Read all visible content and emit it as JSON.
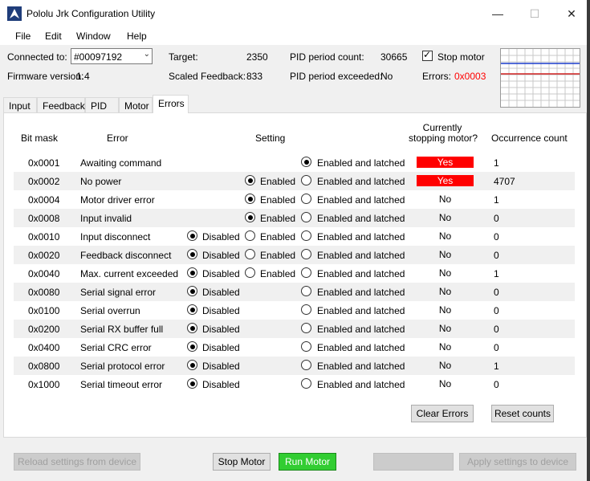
{
  "window": {
    "title": "Pololu Jrk Configuration Utility",
    "controls": {
      "minimize": "—",
      "maximize": "☐",
      "close": "✕"
    }
  },
  "menu": [
    "File",
    "Edit",
    "Window",
    "Help"
  ],
  "status": {
    "connected_label": "Connected to:",
    "device": "#00097192",
    "firmware_label": "Firmware version:",
    "firmware": "1.4",
    "target_label": "Target:",
    "target": "2350",
    "scaled_label": "Scaled Feedback:",
    "scaled": "833",
    "pid_count_label": "PID period count:",
    "pid_count": "30665",
    "pid_exceeded_label": "PID period exceeded:",
    "pid_exceeded": "No",
    "stop_motor_label": "Stop motor",
    "stop_motor_checked": true,
    "errors_label": "Errors:",
    "errors_value": "0x0003",
    "errors_color": "#ff0000"
  },
  "tabs": [
    "Input",
    "Feedback",
    "PID",
    "Motor",
    "Errors"
  ],
  "active_tab": "Errors",
  "table": {
    "headers": {
      "bit_mask": "Bit mask",
      "error": "Error",
      "setting": "Setting",
      "stopping_line1": "Currently",
      "stopping_line2": "stopping motor?",
      "occurrence": "Occurrence count"
    },
    "option_labels": {
      "disabled": "Disabled",
      "enabled": "Enabled",
      "latched": "Enabled and latched"
    },
    "rows": [
      {
        "mask": "0x0001",
        "error": "Awaiting command",
        "options": [
          "latched"
        ],
        "selected": "latched",
        "stopping": "Yes",
        "count": "1"
      },
      {
        "mask": "0x0002",
        "error": "No power",
        "options": [
          "enabled",
          "latched"
        ],
        "selected": "enabled",
        "stopping": "Yes",
        "count": "4707"
      },
      {
        "mask": "0x0004",
        "error": "Motor driver error",
        "options": [
          "enabled",
          "latched"
        ],
        "selected": "enabled",
        "stopping": "No",
        "count": "1"
      },
      {
        "mask": "0x0008",
        "error": "Input invalid",
        "options": [
          "enabled",
          "latched"
        ],
        "selected": "enabled",
        "stopping": "No",
        "count": "0"
      },
      {
        "mask": "0x0010",
        "error": "Input disconnect",
        "options": [
          "disabled",
          "enabled",
          "latched"
        ],
        "selected": "disabled",
        "stopping": "No",
        "count": "0"
      },
      {
        "mask": "0x0020",
        "error": "Feedback disconnect",
        "options": [
          "disabled",
          "enabled",
          "latched"
        ],
        "selected": "disabled",
        "stopping": "No",
        "count": "0"
      },
      {
        "mask": "0x0040",
        "error": "Max. current exceeded",
        "options": [
          "disabled",
          "enabled",
          "latched"
        ],
        "selected": "disabled",
        "stopping": "No",
        "count": "1"
      },
      {
        "mask": "0x0080",
        "error": "Serial signal error",
        "options": [
          "disabled",
          "latched"
        ],
        "selected": "disabled",
        "stopping": "No",
        "count": "0"
      },
      {
        "mask": "0x0100",
        "error": "Serial overrun",
        "options": [
          "disabled",
          "latched"
        ],
        "selected": "disabled",
        "stopping": "No",
        "count": "0"
      },
      {
        "mask": "0x0200",
        "error": "Serial RX buffer full",
        "options": [
          "disabled",
          "latched"
        ],
        "selected": "disabled",
        "stopping": "No",
        "count": "0"
      },
      {
        "mask": "0x0400",
        "error": "Serial CRC error",
        "options": [
          "disabled",
          "latched"
        ],
        "selected": "disabled",
        "stopping": "No",
        "count": "0"
      },
      {
        "mask": "0x0800",
        "error": "Serial protocol error",
        "options": [
          "disabled",
          "latched"
        ],
        "selected": "disabled",
        "stopping": "No",
        "count": "1"
      },
      {
        "mask": "0x1000",
        "error": "Serial timeout error",
        "options": [
          "disabled",
          "latched"
        ],
        "selected": "disabled",
        "stopping": "No",
        "count": "0"
      }
    ]
  },
  "buttons": {
    "clear_errors": "Clear Errors",
    "reset_counts": "Reset counts",
    "reload": "Reload settings from device",
    "stop_motor": "Stop Motor",
    "run_motor": "Run Motor",
    "apply": "Apply settings to device"
  },
  "colors": {
    "stopping_yes_bg": "#ff0000",
    "run_motor_bg": "#32cd32"
  }
}
